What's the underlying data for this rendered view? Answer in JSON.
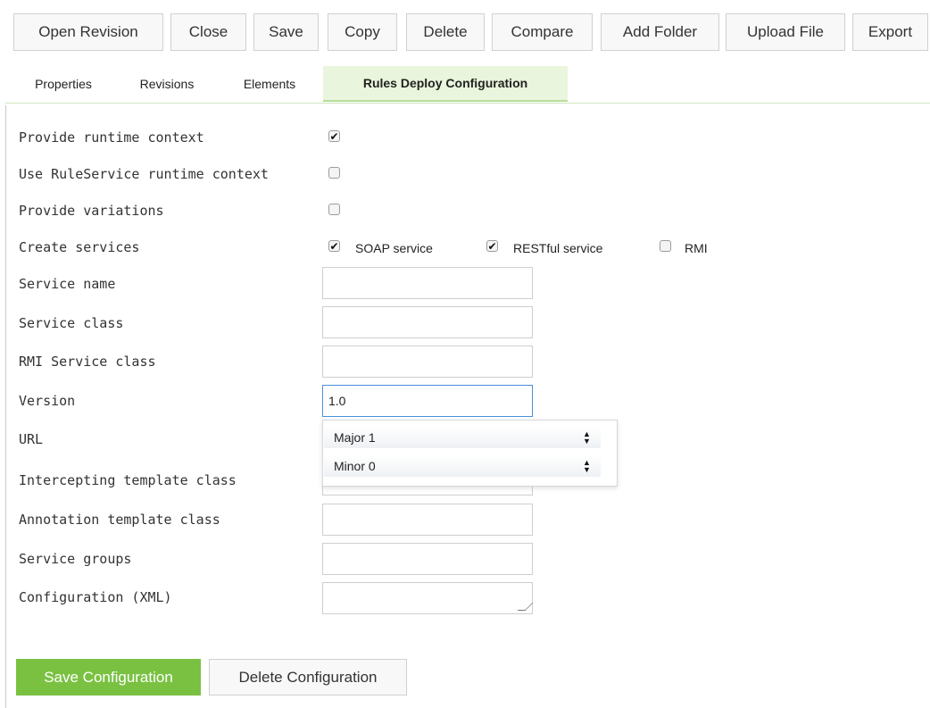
{
  "toolbar": {
    "open_revision": "Open Revision",
    "close": "Close",
    "save": "Save",
    "copy": "Copy",
    "delete": "Delete",
    "compare": "Compare",
    "add_folder": "Add Folder",
    "upload_file": "Upload File",
    "export": "Export"
  },
  "tabs": {
    "properties": "Properties",
    "revisions": "Revisions",
    "elements": "Elements",
    "rules_deploy": "Rules Deploy Configuration"
  },
  "form": {
    "provide_runtime_context": {
      "label": "Provide runtime context",
      "checked": true
    },
    "use_ruleservice_runtime_context": {
      "label": "Use RuleService runtime context",
      "checked": false
    },
    "provide_variations": {
      "label": "Provide variations",
      "checked": false
    },
    "create_services": {
      "label": "Create services",
      "options": [
        {
          "label": "SOAP service",
          "checked": true
        },
        {
          "label": "RESTful service",
          "checked": true
        },
        {
          "label": "RMI",
          "checked": false
        }
      ]
    },
    "service_name": {
      "label": "Service name",
      "value": ""
    },
    "service_class": {
      "label": "Service class",
      "value": ""
    },
    "rmi_service_class": {
      "label": "RMI Service class",
      "value": ""
    },
    "version": {
      "label": "Version",
      "value": "1.0"
    },
    "url": {
      "label": "URL",
      "value": ""
    },
    "intercepting_template_class": {
      "label": "Intercepting template class",
      "value": ""
    },
    "annotation_template_class": {
      "label": "Annotation template class",
      "value": ""
    },
    "service_groups": {
      "label": "Service groups",
      "value": ""
    },
    "configuration_xml": {
      "label": "Configuration (XML)",
      "value": ""
    }
  },
  "version_popup": {
    "major": "Major 1",
    "minor": "Minor 0"
  },
  "actions": {
    "save_configuration": "Save Configuration",
    "delete_configuration": "Delete Configuration"
  },
  "colors": {
    "accent_green": "#7ac142",
    "active_tab_bg": "#e9f5dc",
    "focus_border": "#4a90d9"
  },
  "icons": {
    "checkmark": "check-icon",
    "spinner": "spinner-arrows-icon",
    "resize": "resize-grip-icon"
  }
}
